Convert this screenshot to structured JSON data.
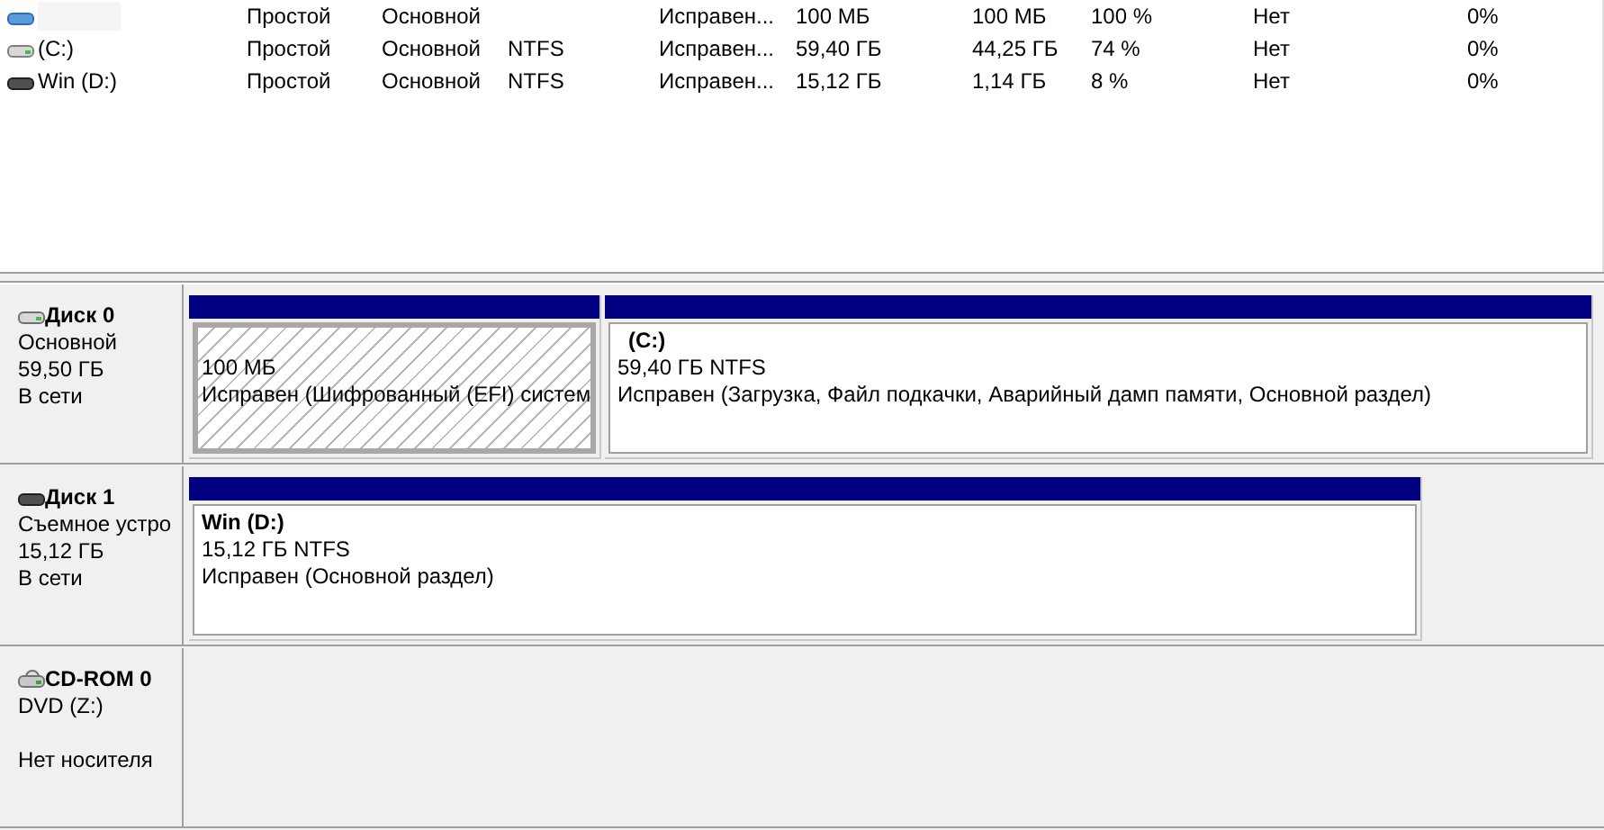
{
  "volumes": [
    {
      "layout": "Простой",
      "type": "Основной",
      "status": "Исправен...",
      "capacity": "100 МБ",
      "free": "100 МБ",
      "free_pct": "100 %",
      "fault_tolerance": "Нет",
      "overhead": "0%"
    },
    {
      "name": "(C:)",
      "layout": "Простой",
      "type": "Основной",
      "fs": "NTFS",
      "status": "Исправен...",
      "capacity": "59,40 ГБ",
      "free": "44,25 ГБ",
      "free_pct": "74 %",
      "fault_tolerance": "Нет",
      "overhead": "0%"
    },
    {
      "name": "Win (D:)",
      "layout": "Простой",
      "type": "Основной",
      "fs": "NTFS",
      "status": "Исправен...",
      "capacity": "15,12 ГБ",
      "free": "1,14 ГБ",
      "free_pct": "8 %",
      "fault_tolerance": "Нет",
      "overhead": "0%"
    }
  ],
  "disks": [
    {
      "kind": "hdd",
      "name": "Диск 0",
      "type": "Основной",
      "size": "59,50 ГБ",
      "status": "В сети",
      "partitions": [
        {
          "size": "100 МБ",
          "status": "Исправен (Шифрованный (EFI) систем",
          "selected": true
        },
        {
          "title": "(C:)",
          "size": "59,40 ГБ NTFS",
          "status": "Исправен (Загрузка, Файл подкачки, Аварийный дамп памяти, Основной раздел)",
          "selected": false
        }
      ]
    },
    {
      "kind": "removable",
      "name": "Диск 1",
      "type": "Съемное устро",
      "size": "15,12 ГБ",
      "status": "В сети",
      "partitions": [
        {
          "title": "Win  (D:)",
          "size": "15,12 ГБ NTFS",
          "status": "Исправен (Основной раздел)",
          "selected": false
        }
      ]
    },
    {
      "kind": "cdrom",
      "name": "CD-ROM 0",
      "type": "DVD (Z:)",
      "status": "Нет носителя"
    }
  ]
}
